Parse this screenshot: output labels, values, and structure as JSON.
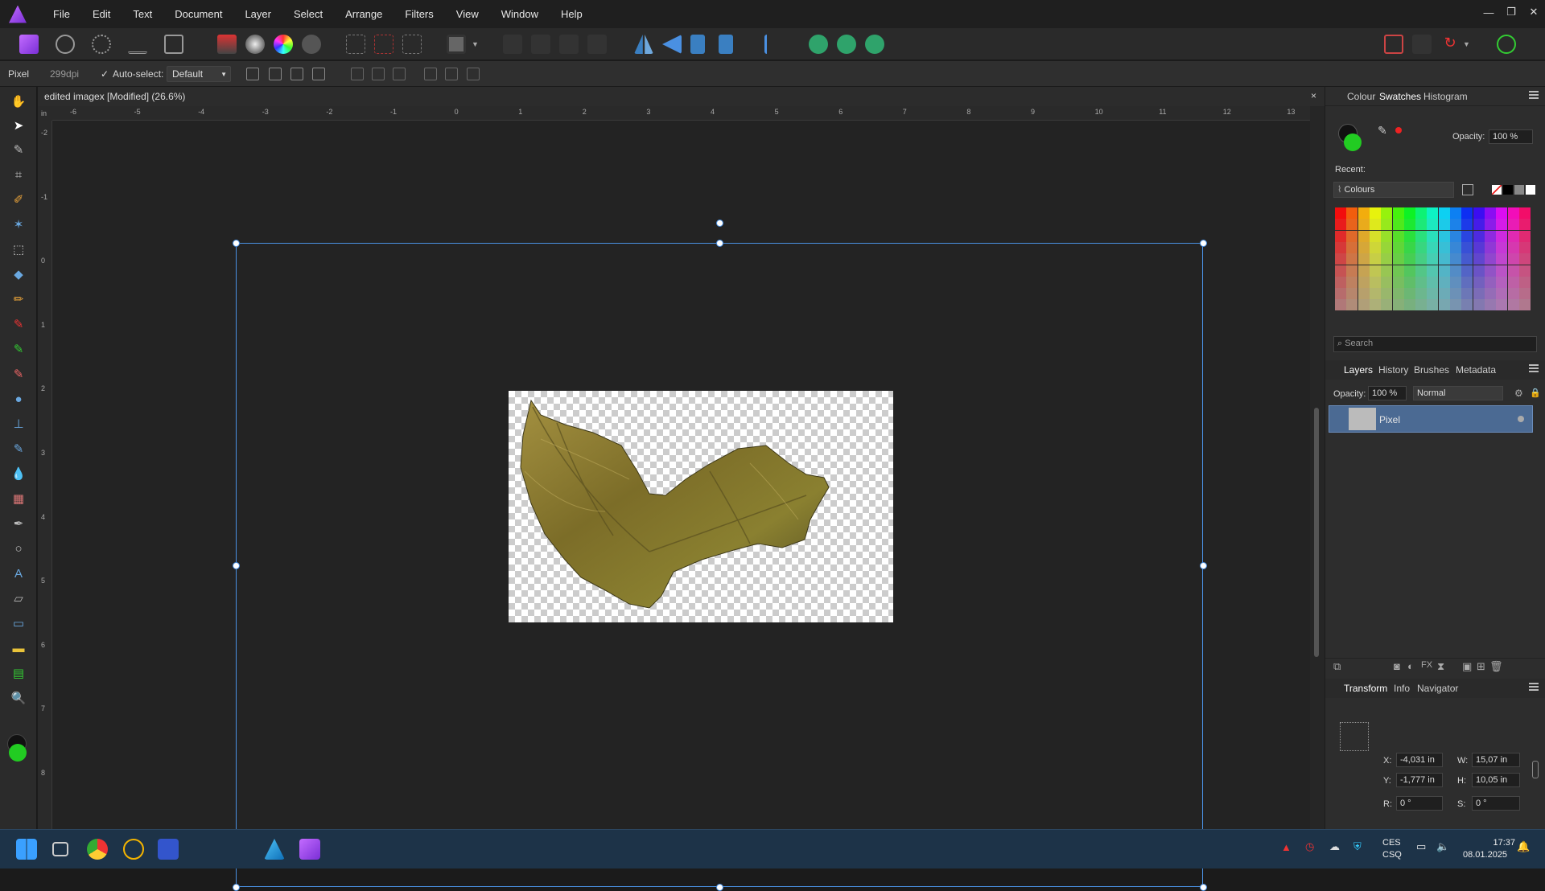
{
  "app": {
    "name": "Affinity Photo",
    "logo_icon": "affinity-photo-logo-icon"
  },
  "menu": [
    "File",
    "Edit",
    "Text",
    "Document",
    "Layer",
    "Select",
    "Arrange",
    "Filters",
    "View",
    "Window",
    "Help"
  ],
  "context_bar": {
    "layer_type": "Pixel",
    "dpi": "299dpi",
    "auto_select_label": "Auto-select:",
    "auto_select_value": "Default"
  },
  "document": {
    "tab_title": "edited imagex [Modified] (26.6%)",
    "close_label": "×"
  },
  "rulers": {
    "unit": "in",
    "h_ticks": [
      "-6",
      "-5",
      "-4",
      "-3",
      "-2",
      "-1",
      "0",
      "1",
      "2",
      "3",
      "4",
      "5",
      "6",
      "7",
      "8",
      "9",
      "10",
      "11",
      "12",
      "13"
    ],
    "v_ticks": [
      "-2",
      "-1",
      "0",
      "1",
      "2",
      "3",
      "4",
      "5",
      "6",
      "7",
      "8"
    ]
  },
  "colour_panel": {
    "tabs": [
      "Colour",
      "Swatches",
      "Histogram"
    ],
    "active_tab": "Swatches",
    "opacity_label": "Opacity:",
    "opacity_value": "100 %",
    "recent_label": "Recent:",
    "palette_name": "Colours",
    "search_placeholder": "Search",
    "fill_color": "#111111",
    "stroke_color": "#22cc22"
  },
  "layers_panel": {
    "tabs": [
      "Layers",
      "History",
      "Brushes",
      "Metadata"
    ],
    "active_tab": "Layers",
    "opacity_label": "Opacity:",
    "opacity_value": "100 %",
    "blend_mode": "Normal",
    "layers": [
      {
        "name": "Pixel"
      }
    ]
  },
  "transform_panel": {
    "tabs": [
      "Transform",
      "Info",
      "Navigator"
    ],
    "active_tab": "Transform",
    "x_label": "X:",
    "x_value": "-4,031 in",
    "y_label": "Y:",
    "y_value": "-1,777 in",
    "w_label": "W:",
    "w_value": "15,07 in",
    "h_label": "H:",
    "h_value": "10,05 in",
    "r_label": "R:",
    "r_value": "0 °",
    "s_label": "S:",
    "s_value": "0 °"
  },
  "taskbar": {
    "lang_top": "CES",
    "lang_bottom": "CSQ",
    "time": "17:37",
    "date": "08.01.2025"
  }
}
